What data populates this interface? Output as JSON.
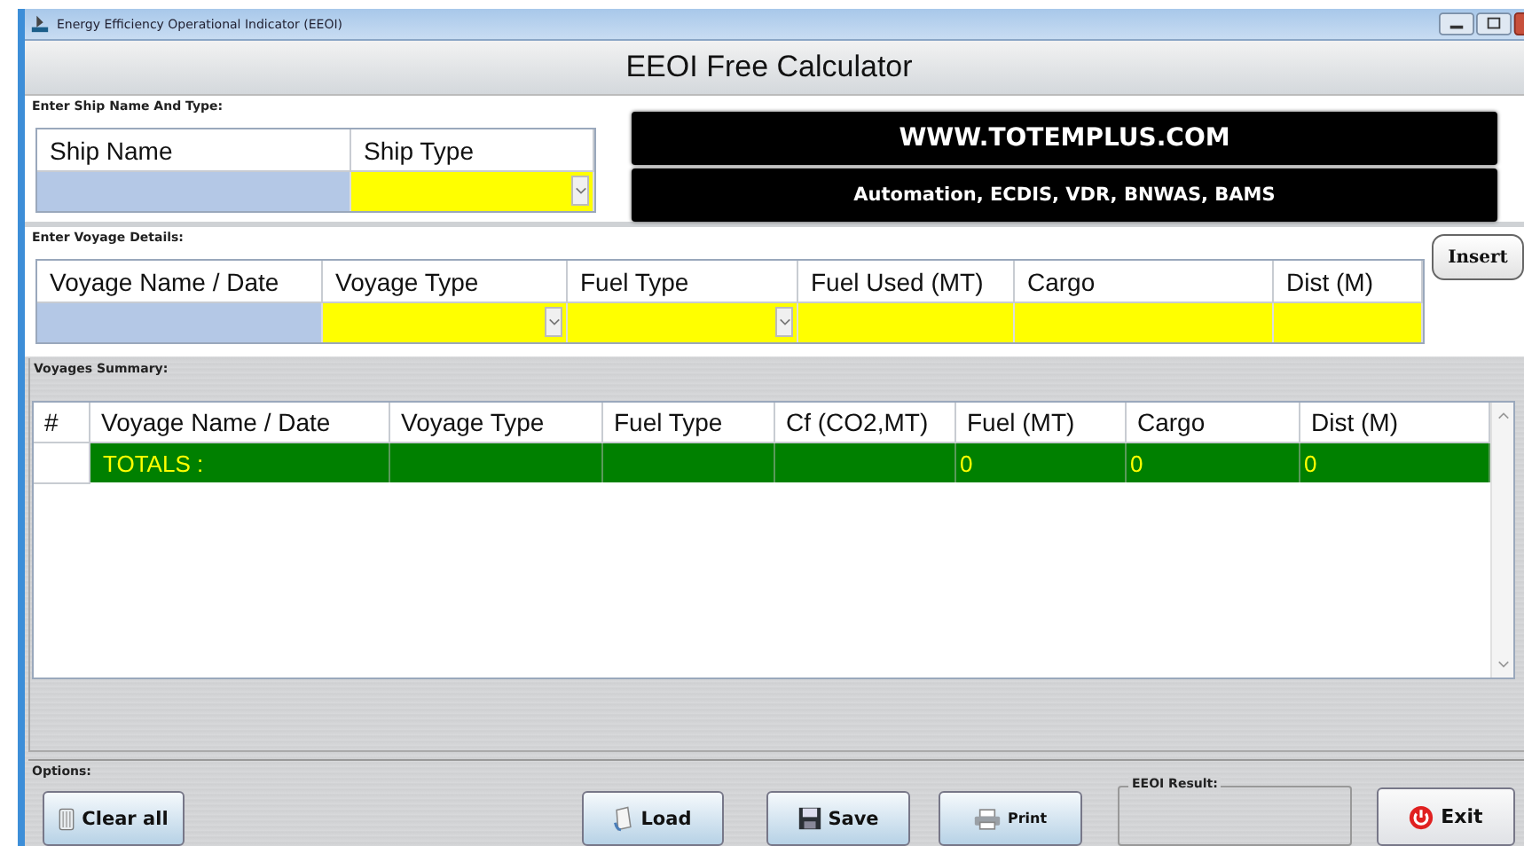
{
  "window": {
    "title": "Energy Efficiency Operational Indicator (EEOI)"
  },
  "header": {
    "title": "EEOI Free Calculator"
  },
  "ship_section": {
    "label": "Enter Ship Name And Type:",
    "columns": [
      {
        "label": "Ship Name",
        "kind": "text"
      },
      {
        "label": "Ship Type",
        "kind": "dropdown"
      }
    ]
  },
  "banner": {
    "line_1": "WWW.TOTEMPLUS.COM",
    "line_2": "Automation, ECDIS, VDR, BNWAS, BAMS"
  },
  "voyage_section": {
    "label": "Enter Voyage Details:",
    "columns": [
      {
        "label": "Voyage Name / Date",
        "kind": "text"
      },
      {
        "label": "Voyage Type",
        "kind": "dropdown"
      },
      {
        "label": "Fuel Type",
        "kind": "dropdown"
      },
      {
        "label": "Fuel Used (MT)",
        "kind": "number"
      },
      {
        "label": "Cargo",
        "kind": "number"
      },
      {
        "label": "Dist (M)",
        "kind": "number"
      }
    ],
    "insert_button": "Insert"
  },
  "summary": {
    "label": "Voyages Summary:",
    "columns": [
      "#",
      "Voyage Name / Date",
      "Voyage Type",
      "Fuel Type",
      "Cf (CO2,MT)",
      "Fuel (MT)",
      "Cargo",
      "Dist (M)"
    ],
    "totals_row": {
      "label": "TOTALS :",
      "values": [
        "0",
        "0",
        "0"
      ]
    }
  },
  "options": {
    "label": "Options:",
    "buttons": [
      {
        "label": "Clear all",
        "kind": "clear"
      },
      {
        "label": "Load",
        "kind": "load"
      },
      {
        "label": "Save",
        "kind": "save"
      },
      {
        "label": "Print",
        "kind": "print"
      }
    ],
    "result": {
      "label": "EEOI Result:"
    },
    "exit_button": "Exit"
  }
}
